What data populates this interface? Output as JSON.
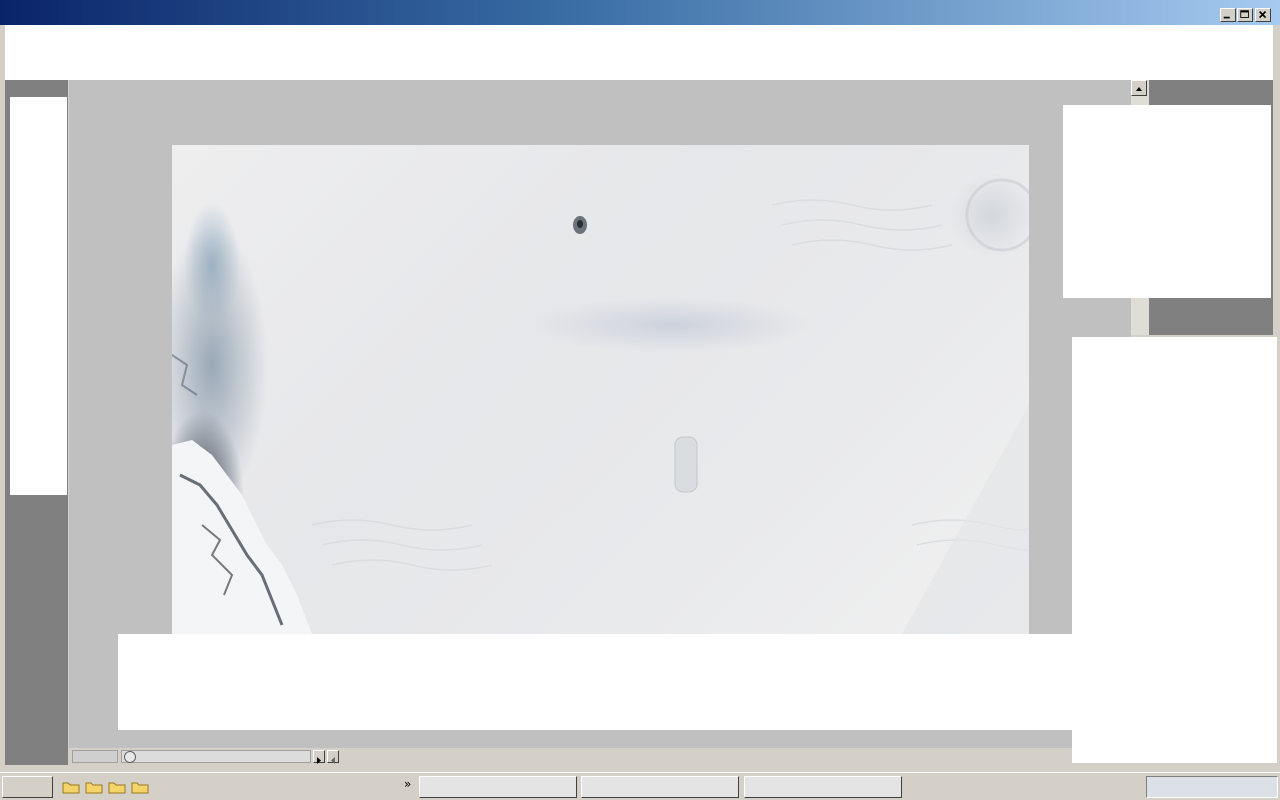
{
  "window": {
    "title": "",
    "controls": [
      "minimize-icon",
      "maximize-icon",
      "close-icon"
    ]
  },
  "colors": {
    "titlebar_start": "#0a246a",
    "titlebar_end": "#a6caf0",
    "canvas_bg": "#c0c0c0",
    "panel_gray": "#808080",
    "chrome": "#d4d0c8"
  },
  "image": {
    "subject": "satellite-image"
  },
  "taskbar": {
    "start_label": "",
    "quicklaunch_icons": [
      "folder-icon",
      "folder-icon",
      "folder-icon",
      "folder-icon"
    ],
    "overflow_label": "»",
    "tasks": [
      "",
      "",
      ""
    ]
  }
}
